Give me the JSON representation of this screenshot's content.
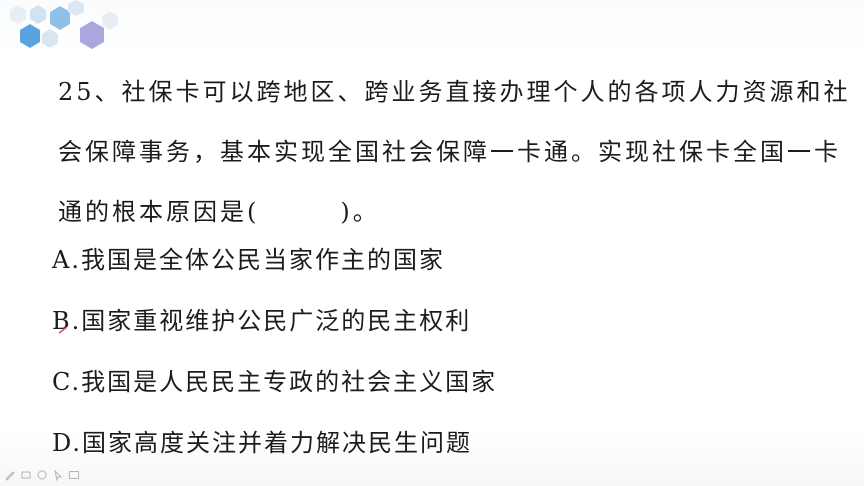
{
  "question": {
    "lines": [
      "25、社保卡可以跨地区、跨业务直接办理个人的各项人力资源和社",
      "会保障事务，基本实现全国社会保障一卡通。实现社保卡全国一卡",
      "通的根本原因是(　　　)。"
    ]
  },
  "options": [
    {
      "text": "A.我国是全体公民当家作主的国家"
    },
    {
      "text": "B.国家重视维护公民广泛的民主权利"
    },
    {
      "text": "C.我国是人民民主专政的社会主义国家"
    },
    {
      "text": "D.国家高度关注并着力解决民生问题"
    }
  ],
  "colors": {
    "hex_blue": "#5aa3e0",
    "hex_light": "#cfe3f3",
    "hex_mid": "#8fc0e8",
    "hex_purple": "#a9a7dd",
    "pen_red": "#d9534f"
  },
  "toolbar": {
    "icons": [
      "pen-icon",
      "highlighter-icon",
      "eraser-icon",
      "pointer-icon",
      "screen-icon"
    ]
  }
}
